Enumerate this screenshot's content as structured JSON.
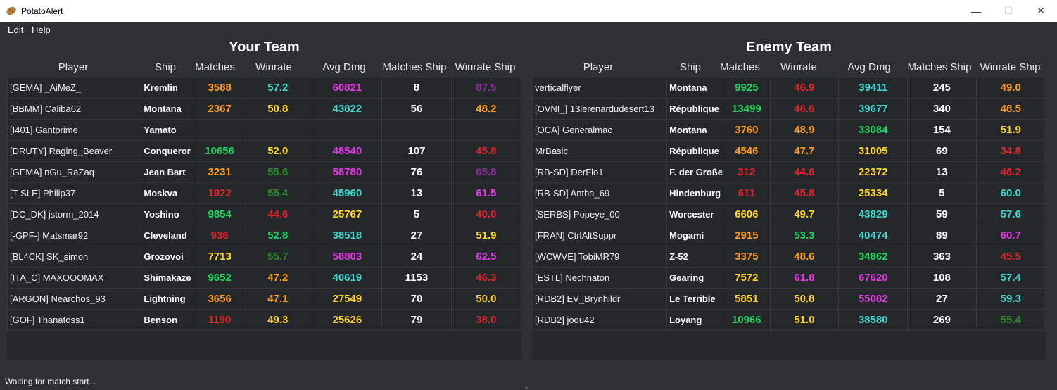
{
  "window": {
    "title": "PotatoAlert"
  },
  "menu": {
    "edit": "Edit",
    "help": "Help"
  },
  "columns": [
    "Player",
    "Ship",
    "Matches",
    "Winrate",
    "Avg Dmg",
    "Matches Ship",
    "Winrate Ship"
  ],
  "colors": {
    "white": "#ffffff",
    "green": "#1ed760",
    "darkgreen": "#2a8a2a",
    "orange": "#ff9c1a",
    "yellow": "#ffd42a",
    "red": "#e0262c",
    "cyan": "#40d8d0",
    "magenta": "#e43ae6",
    "purple": "#8a2f9c"
  },
  "your_team": {
    "title": "Your Team",
    "rows": [
      {
        "player": "[GEMA] _AiMeZ_",
        "ship": "Kremlin",
        "matches": "3588",
        "matches_c": "orange",
        "winrate": "57.2",
        "winrate_c": "cyan",
        "dmg": "60821",
        "dmg_c": "magenta",
        "mship": "8",
        "wship": "87.5",
        "wship_c": "purple"
      },
      {
        "player": "[BBMM] Caliba62",
        "ship": "Montana",
        "matches": "2367",
        "matches_c": "orange",
        "winrate": "50.8",
        "winrate_c": "yellow",
        "dmg": "43822",
        "dmg_c": "cyan",
        "mship": "56",
        "wship": "48.2",
        "wship_c": "orange"
      },
      {
        "player": "[I401] Gantprime",
        "ship": "Yamato",
        "matches": "",
        "matches_c": "white",
        "winrate": "",
        "winrate_c": "white",
        "dmg": "",
        "dmg_c": "white",
        "mship": "",
        "wship": "",
        "wship_c": "white"
      },
      {
        "player": "[DRUTY] Raging_Beaver",
        "ship": "Conqueror",
        "matches": "10656",
        "matches_c": "green",
        "winrate": "52.0",
        "winrate_c": "yellow",
        "dmg": "48540",
        "dmg_c": "magenta",
        "mship": "107",
        "wship": "45.8",
        "wship_c": "red"
      },
      {
        "player": "[GEMA] nGu_RaZaq",
        "ship": "Jean Bart",
        "matches": "3231",
        "matches_c": "orange",
        "winrate": "55.6",
        "winrate_c": "darkgreen",
        "dmg": "58780",
        "dmg_c": "magenta",
        "mship": "76",
        "wship": "65.8",
        "wship_c": "purple"
      },
      {
        "player": "[T-SLE] Philip37",
        "ship": "Moskva",
        "matches": "1922",
        "matches_c": "red",
        "winrate": "55.4",
        "winrate_c": "darkgreen",
        "dmg": "45960",
        "dmg_c": "cyan",
        "mship": "13",
        "wship": "61.5",
        "wship_c": "magenta"
      },
      {
        "player": "[DC_DK] jstorm_2014",
        "ship": "Yoshino",
        "matches": "9854",
        "matches_c": "green",
        "winrate": "44.6",
        "winrate_c": "red",
        "dmg": "25767",
        "dmg_c": "yellow",
        "mship": "5",
        "wship": "40.0",
        "wship_c": "red"
      },
      {
        "player": "[-GPF-] Matsmar92",
        "ship": "Cleveland",
        "matches": "936",
        "matches_c": "red",
        "winrate": "52.8",
        "winrate_c": "green",
        "dmg": "38518",
        "dmg_c": "cyan",
        "mship": "27",
        "wship": "51.9",
        "wship_c": "yellow"
      },
      {
        "player": "[BL4CK] SK_simon",
        "ship": "Grozovoi",
        "matches": "7713",
        "matches_c": "yellow",
        "winrate": "55.7",
        "winrate_c": "darkgreen",
        "dmg": "58803",
        "dmg_c": "magenta",
        "mship": "24",
        "wship": "62.5",
        "wship_c": "magenta"
      },
      {
        "player": "[ITA_C] MAXOOOMAX",
        "ship": "Shimakaze",
        "matches": "9652",
        "matches_c": "green",
        "winrate": "47.2",
        "winrate_c": "orange",
        "dmg": "40619",
        "dmg_c": "cyan",
        "mship": "1153",
        "wship": "46.3",
        "wship_c": "red"
      },
      {
        "player": "[ARGON] Nearchos_93",
        "ship": "Lightning",
        "matches": "3656",
        "matches_c": "orange",
        "winrate": "47.1",
        "winrate_c": "orange",
        "dmg": "27549",
        "dmg_c": "yellow",
        "mship": "70",
        "wship": "50.0",
        "wship_c": "yellow"
      },
      {
        "player": "[GOF] Thanatoss1",
        "ship": "Benson",
        "matches": "1190",
        "matches_c": "red",
        "winrate": "49.3",
        "winrate_c": "yellow",
        "dmg": "25626",
        "dmg_c": "yellow",
        "mship": "79",
        "wship": "38.0",
        "wship_c": "red"
      }
    ]
  },
  "enemy_team": {
    "title": "Enemy Team",
    "rows": [
      {
        "player": "verticalflyer",
        "ship": "Montana",
        "matches": "9925",
        "matches_c": "green",
        "winrate": "46.9",
        "winrate_c": "red",
        "dmg": "39411",
        "dmg_c": "cyan",
        "mship": "245",
        "wship": "49.0",
        "wship_c": "orange"
      },
      {
        "player": "[OVNI_] 13lerenardudesert13",
        "ship": "République",
        "matches": "13499",
        "matches_c": "green",
        "winrate": "46.6",
        "winrate_c": "red",
        "dmg": "39677",
        "dmg_c": "cyan",
        "mship": "340",
        "wship": "48.5",
        "wship_c": "orange"
      },
      {
        "player": "[OCA] Generalmac",
        "ship": "Montana",
        "matches": "3760",
        "matches_c": "orange",
        "winrate": "48.9",
        "winrate_c": "orange",
        "dmg": "33084",
        "dmg_c": "green",
        "mship": "154",
        "wship": "51.9",
        "wship_c": "yellow"
      },
      {
        "player": "MrBasic",
        "ship": "République",
        "matches": "4546",
        "matches_c": "orange",
        "winrate": "47.7",
        "winrate_c": "orange",
        "dmg": "31005",
        "dmg_c": "yellow",
        "mship": "69",
        "wship": "34.8",
        "wship_c": "red"
      },
      {
        "player": "[RB-SD] DerFlo1",
        "ship": "F. der Große",
        "matches": "312",
        "matches_c": "red",
        "winrate": "44.6",
        "winrate_c": "red",
        "dmg": "22372",
        "dmg_c": "yellow",
        "mship": "13",
        "wship": "46.2",
        "wship_c": "red"
      },
      {
        "player": "[RB-SD] Antha_69",
        "ship": "Hindenburg",
        "matches": "611",
        "matches_c": "red",
        "winrate": "45.8",
        "winrate_c": "red",
        "dmg": "25334",
        "dmg_c": "yellow",
        "mship": "5",
        "wship": "60.0",
        "wship_c": "cyan"
      },
      {
        "player": "[SERBS] Popeye_00",
        "ship": "Worcester",
        "matches": "6606",
        "matches_c": "yellow",
        "winrate": "49.7",
        "winrate_c": "yellow",
        "dmg": "43829",
        "dmg_c": "cyan",
        "mship": "59",
        "wship": "57.6",
        "wship_c": "cyan"
      },
      {
        "player": "[FRAN] CtrlAltSuppr",
        "ship": "Mogami",
        "matches": "2915",
        "matches_c": "orange",
        "winrate": "53.3",
        "winrate_c": "green",
        "dmg": "40474",
        "dmg_c": "cyan",
        "mship": "89",
        "wship": "60.7",
        "wship_c": "magenta"
      },
      {
        "player": "[WCWVE] TobiMR79",
        "ship": "Z-52",
        "matches": "3375",
        "matches_c": "orange",
        "winrate": "48.6",
        "winrate_c": "orange",
        "dmg": "34862",
        "dmg_c": "green",
        "mship": "363",
        "wship": "45.5",
        "wship_c": "red"
      },
      {
        "player": "[ESTL] Nechnaton",
        "ship": "Gearing",
        "matches": "7572",
        "matches_c": "yellow",
        "winrate": "61.8",
        "winrate_c": "magenta",
        "dmg": "67620",
        "dmg_c": "magenta",
        "mship": "108",
        "wship": "57.4",
        "wship_c": "cyan"
      },
      {
        "player": "[RDB2] EV_Brynhildr",
        "ship": "Le Terrible",
        "matches": "5851",
        "matches_c": "yellow",
        "winrate": "50.8",
        "winrate_c": "yellow",
        "dmg": "55082",
        "dmg_c": "magenta",
        "mship": "27",
        "wship": "59.3",
        "wship_c": "cyan"
      },
      {
        "player": "[RDB2] jodu42",
        "ship": "Loyang",
        "matches": "10966",
        "matches_c": "green",
        "winrate": "51.0",
        "winrate_c": "yellow",
        "dmg": "38580",
        "dmg_c": "cyan",
        "mship": "269",
        "wship": "55.4",
        "wship_c": "darkgreen"
      }
    ]
  },
  "status": {
    "text": "Waiting for match start..."
  }
}
